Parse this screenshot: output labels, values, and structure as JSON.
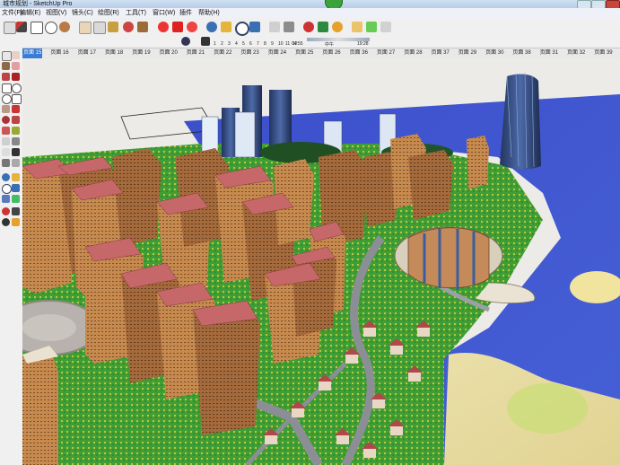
{
  "window": {
    "title": "城市规划 - SketchUp Pro"
  },
  "menu": {
    "items": [
      "文件(F)",
      "编辑(E)",
      "视图(V)",
      "镜头(C)",
      "绘图(R)",
      "工具(T)",
      "窗口(W)",
      "插件",
      "帮助(H)"
    ]
  },
  "shadow_bar": {
    "months": [
      "1",
      "2",
      "3",
      "4",
      "5",
      "6",
      "7",
      "8",
      "9",
      "10",
      "11",
      "12"
    ],
    "time_start": "04:55",
    "time_mid": "中午",
    "time_end": "19:28"
  },
  "scenes": {
    "tabs": [
      "页面 15",
      "页面 16",
      "页面 17",
      "页面 18",
      "页面 19",
      "页面 20",
      "页面 21",
      "页面 22",
      "页面 23",
      "页面 24",
      "页面 25",
      "页面 26",
      "页面 36",
      "页面 27",
      "页面 28",
      "页面 37",
      "页面 29",
      "页面 30",
      "页面 38",
      "页面 31",
      "页面 32",
      "页面 39"
    ],
    "active_index": 0
  },
  "colors": {
    "sky": "#ecebe7",
    "water": "#3f51c9",
    "grass": "#47a23a",
    "road": "#8b8f95",
    "building": "#c7894c"
  },
  "icons": [
    "select-icon",
    "eraser-icon",
    "pencil-icon",
    "rectangle-icon",
    "circle-icon",
    "polygon-icon",
    "push-pull-icon",
    "move-icon",
    "rotate-icon",
    "orbit-icon",
    "pan-icon",
    "zoom-icon",
    "tape-icon",
    "paint-icon",
    "walk-icon",
    "look-icon",
    "section-icon"
  ]
}
